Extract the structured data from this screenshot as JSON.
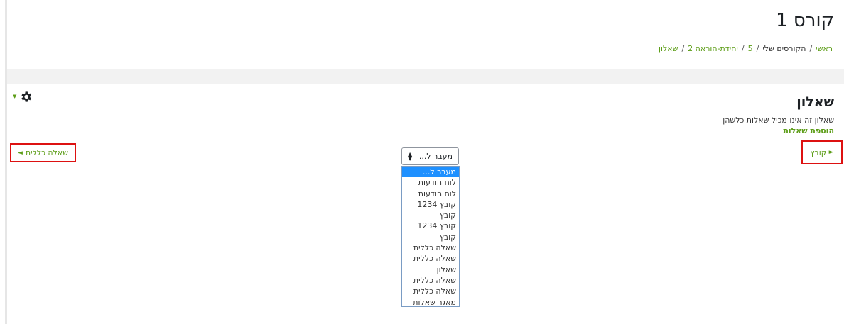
{
  "course": {
    "title": "קורס 1"
  },
  "breadcrumb": {
    "items": [
      "ראשי",
      "הקורסים שלי",
      "5",
      "יחידת-הוראה 2",
      "שאלון"
    ],
    "separator": "/"
  },
  "activity": {
    "title": "שאלון",
    "description": "שאלון זה אינו מכיל שאלות כלשהן",
    "add_questions_label": "הוספת שאלות"
  },
  "navigation": {
    "prev_label": "קובץ",
    "prev_arrow": "►",
    "next_label": "שאלה כללית",
    "next_arrow": "◄"
  },
  "jump": {
    "selected_label": "מעבר ל...",
    "options": [
      "מעבר ל...",
      "לוח הודעות",
      "לוח הודעות",
      "קובץ 1234",
      "קובץ",
      "קובץ 1234",
      "קובץ",
      "שאלה כללית",
      "שאלה כללית",
      "שאלון",
      "שאלה כללית",
      "שאלה כללית",
      "מאגר שאלות"
    ]
  },
  "icons": {
    "settings": "gear-icon",
    "menu_caret": "caret-down-icon"
  },
  "colors": {
    "link": "#5c9d17",
    "highlight": "#dd1111",
    "selected_option": "#1e90ff"
  }
}
